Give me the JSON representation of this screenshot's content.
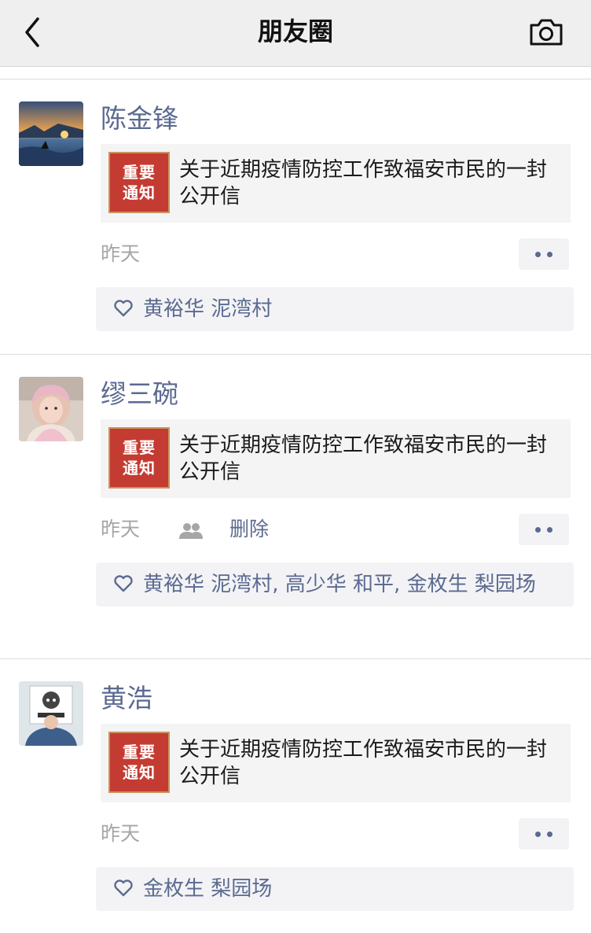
{
  "nav": {
    "back_icon": "chevron-left-icon",
    "title": "朋友圈",
    "camera_icon": "camera-icon"
  },
  "colors": {
    "link_blue": "#5b6a91",
    "notice_red": "#c43b32",
    "muted_gray": "#a6a6a6",
    "card_bg": "#f4f4f4",
    "navbar_bg": "#efefef"
  },
  "posts": [
    {
      "author": "陈金锋",
      "avatar": "avatar-seascape",
      "link": {
        "thumb_text": "重要通知",
        "title": "关于近期疫情防控工作致福安市民的一封公开信"
      },
      "time": "昨天",
      "likes": "黄裕华 泥湾村"
    },
    {
      "author": "缪三碗",
      "avatar": "avatar-child",
      "link": {
        "thumb_text": "重要通知",
        "title": "关于近期疫情防控工作致福安市民的一封公开信"
      },
      "time": "昨天",
      "delete_label": "删除",
      "likes": "黄裕华 泥湾村, 高少华 和平, 金枚生 梨园场"
    },
    {
      "author": "黄浩",
      "avatar": "avatar-sign",
      "link": {
        "thumb_text": "重要通知",
        "title": "关于近期疫情防控工作致福安市民的一封公开信"
      },
      "time": "昨天",
      "likes": "金枚生 梨园场"
    }
  ]
}
